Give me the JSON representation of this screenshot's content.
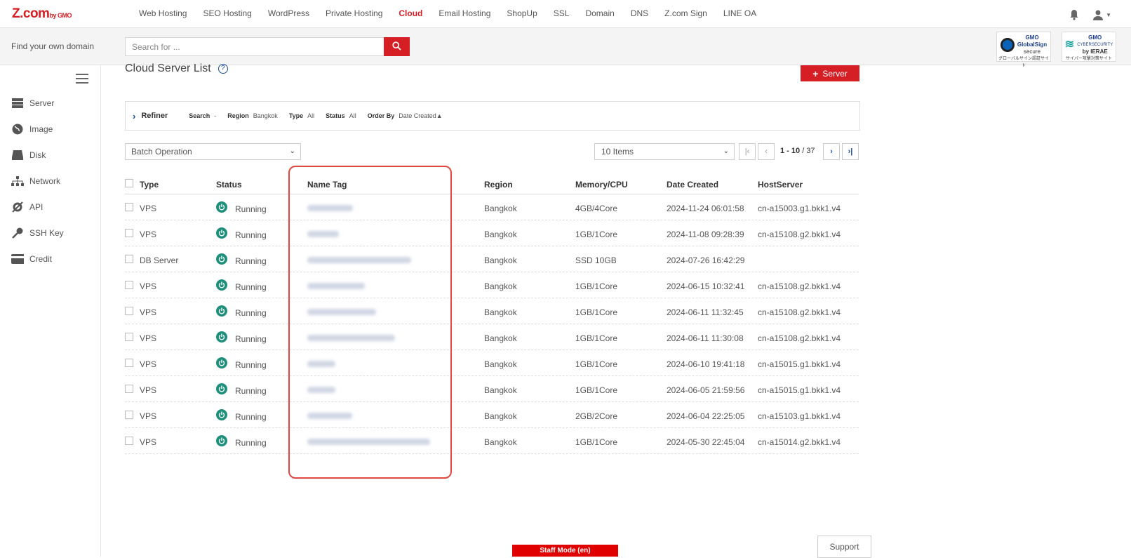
{
  "brand": {
    "logo_main": "Z.com",
    "logo_sub": "by GMO"
  },
  "topnav": {
    "links": [
      "Web Hosting",
      "SEO Hosting",
      "WordPress",
      "Private Hosting",
      "Cloud",
      "Email Hosting",
      "ShopUp",
      "SSL",
      "Domain",
      "DNS",
      "Z.com Sign",
      "LINE OA"
    ],
    "active": "Cloud",
    "icons": [
      "bell-icon",
      "user-icon"
    ]
  },
  "searchbar": {
    "label": "Find your own domain",
    "placeholder": "Search for ...",
    "badge1": {
      "line1": "GMO",
      "line2": "GlobalSign",
      "line3": "secure",
      "line4": "グローバルサイン認証サイト"
    },
    "badge2": {
      "line1": "GMO",
      "line2": "CYBERSECURITY",
      "line3": "by IERAE",
      "line4": "サイバー攻撃対策サイト"
    }
  },
  "sidebar": {
    "items": [
      {
        "label": "Server",
        "icon": "server-icon"
      },
      {
        "label": "Image",
        "icon": "globe-icon"
      },
      {
        "label": "Disk",
        "icon": "disk-icon"
      },
      {
        "label": "Network",
        "icon": "network-icon"
      },
      {
        "label": "API",
        "icon": "api-icon"
      },
      {
        "label": "SSH Key",
        "icon": "key-icon"
      },
      {
        "label": "Credit",
        "icon": "credit-card-icon"
      }
    ]
  },
  "main": {
    "title": "Cloud Server List",
    "add_button": "Server",
    "refiner": {
      "title": "Refiner",
      "fields": [
        {
          "key": "Search",
          "value": "-"
        },
        {
          "key": "Region",
          "value": "Bangkok"
        },
        {
          "key": "Type",
          "value": "All"
        },
        {
          "key": "Status",
          "value": "All"
        },
        {
          "key": "Order By",
          "value": "Date Created▲"
        }
      ]
    },
    "batch_label": "Batch Operation",
    "items_label": "10 Items",
    "pagination": {
      "range": "1 - 10",
      "total": "37"
    }
  },
  "table": {
    "headers": {
      "type": "Type",
      "status": "Status",
      "name": "Name Tag",
      "region": "Region",
      "memory": "Memory/CPU",
      "date": "Date Created",
      "host": "HostServer"
    },
    "rows": [
      {
        "type": "VPS",
        "status": "Running",
        "region": "Bangkok",
        "memory": "4GB/4Core",
        "date": "2024-11-24 06:01:58",
        "host": "cn-a15003.g1.bkk1.v4",
        "name_blur": 65
      },
      {
        "type": "VPS",
        "status": "Running",
        "region": "Bangkok",
        "memory": "1GB/1Core",
        "date": "2024-11-08 09:28:39",
        "host": "cn-a15108.g2.bkk1.v4",
        "name_blur": 45
      },
      {
        "type": "DB Server",
        "status": "Running",
        "region": "Bangkok",
        "memory": "SSD 10GB",
        "date": "2024-07-26 16:42:29",
        "host": "",
        "name_blur": 148
      },
      {
        "type": "VPS",
        "status": "Running",
        "region": "Bangkok",
        "memory": "1GB/1Core",
        "date": "2024-06-15 10:32:41",
        "host": "cn-a15108.g2.bkk1.v4",
        "name_blur": 82
      },
      {
        "type": "VPS",
        "status": "Running",
        "region": "Bangkok",
        "memory": "1GB/1Core",
        "date": "2024-06-11 11:32:45",
        "host": "cn-a15108.g2.bkk1.v4",
        "name_blur": 98
      },
      {
        "type": "VPS",
        "status": "Running",
        "region": "Bangkok",
        "memory": "1GB/1Core",
        "date": "2024-06-11 11:30:08",
        "host": "cn-a15108.g2.bkk1.v4",
        "name_blur": 125
      },
      {
        "type": "VPS",
        "status": "Running",
        "region": "Bangkok",
        "memory": "1GB/1Core",
        "date": "2024-06-10 19:41:18",
        "host": "cn-a15015.g1.bkk1.v4",
        "name_blur": 40
      },
      {
        "type": "VPS",
        "status": "Running",
        "region": "Bangkok",
        "memory": "1GB/1Core",
        "date": "2024-06-05 21:59:56",
        "host": "cn-a15015.g1.bkk1.v4",
        "name_blur": 40
      },
      {
        "type": "VPS",
        "status": "Running",
        "region": "Bangkok",
        "memory": "2GB/2Core",
        "date": "2024-06-04 22:25:05",
        "host": "cn-a15103.g1.bkk1.v4",
        "name_blur": 64
      },
      {
        "type": "VPS",
        "status": "Running",
        "region": "Bangkok",
        "memory": "1GB/1Core",
        "date": "2024-05-30 22:45:04",
        "host": "cn-a15014.g2.bkk1.v4",
        "name_blur": 175
      }
    ]
  },
  "footer": {
    "staff_mode": "Staff Mode (en)",
    "support": "Support"
  }
}
